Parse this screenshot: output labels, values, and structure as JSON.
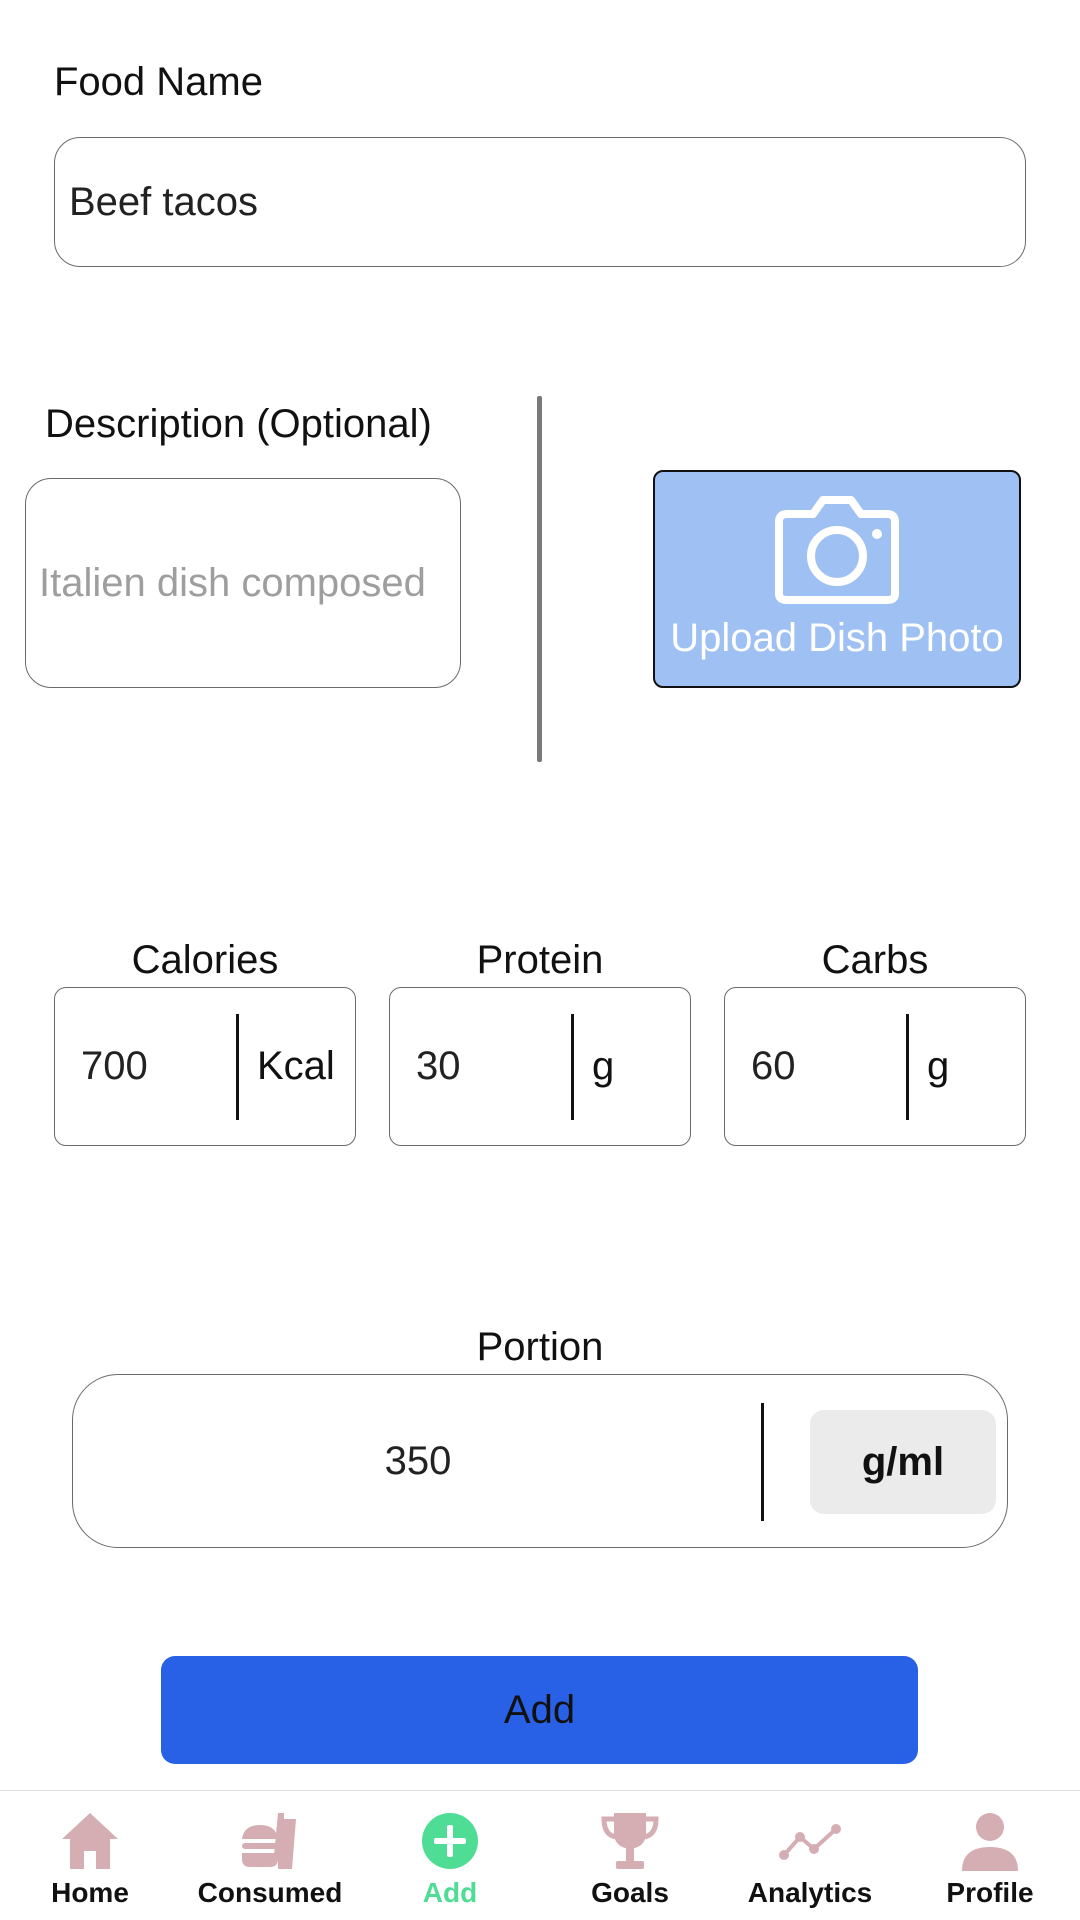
{
  "form": {
    "food_name_label": "Food Name",
    "food_name_value": "Beef tacos",
    "description_label": "Description (Optional)",
    "description_placeholder": "Italien dish composed",
    "upload_label": "Upload Dish Photo"
  },
  "macros": [
    {
      "label": "Calories",
      "value": "700",
      "unit": "Kcal"
    },
    {
      "label": "Protein",
      "value": "30",
      "unit": "g"
    },
    {
      "label": "Carbs",
      "value": "60",
      "unit": "g"
    }
  ],
  "portion": {
    "label": "Portion",
    "value": "350",
    "unit": "g/ml"
  },
  "add_button_label": "Add",
  "nav": {
    "items": [
      {
        "label": "Home",
        "icon": "home-icon"
      },
      {
        "label": "Consumed",
        "icon": "fastfood-icon"
      },
      {
        "label": "Add",
        "icon": "add-circle-icon",
        "active": true
      },
      {
        "label": "Goals",
        "icon": "trophy-icon"
      },
      {
        "label": "Analytics",
        "icon": "line-chart-icon"
      },
      {
        "label": "Profile",
        "icon": "person-icon"
      }
    ]
  },
  "colors": {
    "primary_button": "#2861e6",
    "upload_button": "#9ec0f2",
    "nav_icon": "#d5aeb4",
    "nav_active": "#4fdc95"
  }
}
